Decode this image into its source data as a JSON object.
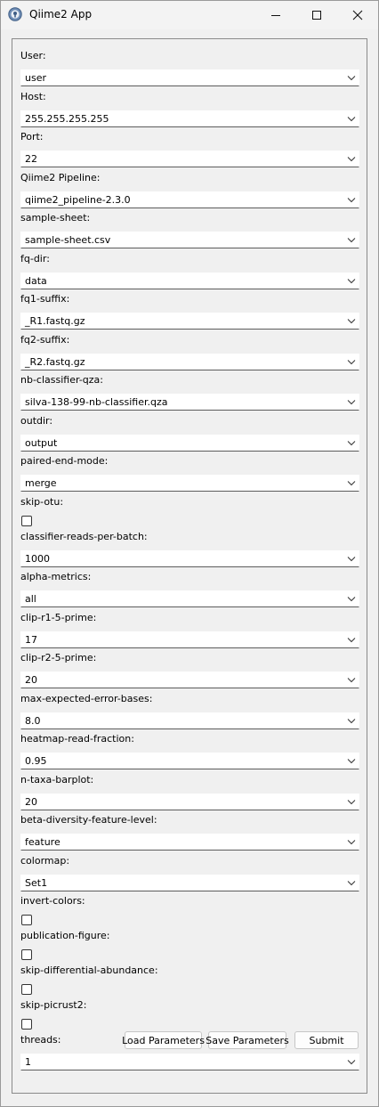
{
  "window": {
    "title": "Qiime2 App",
    "icon": "app-logo-icon",
    "controls": [
      "minimize-icon",
      "maximize-icon",
      "close-icon"
    ]
  },
  "fields": [
    {
      "label": "User:",
      "type": "combo",
      "value": "user"
    },
    {
      "label": "Host:",
      "type": "combo",
      "value": "255.255.255.255"
    },
    {
      "label": "Port:",
      "type": "combo",
      "value": "22"
    },
    {
      "label": "Qiime2 Pipeline:",
      "type": "combo",
      "value": "qiime2_pipeline-2.3.0"
    },
    {
      "label": "sample-sheet:",
      "type": "combo",
      "value": "sample-sheet.csv"
    },
    {
      "label": "fq-dir:",
      "type": "combo",
      "value": "data"
    },
    {
      "label": "fq1-suffix:",
      "type": "combo",
      "value": "_R1.fastq.gz"
    },
    {
      "label": "fq2-suffix:",
      "type": "combo",
      "value": "_R2.fastq.gz"
    },
    {
      "label": "nb-classifier-qza:",
      "type": "combo",
      "value": "silva-138-99-nb-classifier.qza"
    },
    {
      "label": "outdir:",
      "type": "combo",
      "value": "output"
    },
    {
      "label": "paired-end-mode:",
      "type": "combo",
      "value": "merge"
    },
    {
      "label": "skip-otu:",
      "type": "checkbox",
      "checked": false
    },
    {
      "label": "classifier-reads-per-batch:",
      "type": "combo",
      "value": "1000"
    },
    {
      "label": "alpha-metrics:",
      "type": "combo",
      "value": "all"
    },
    {
      "label": "clip-r1-5-prime:",
      "type": "combo",
      "value": "17"
    },
    {
      "label": "clip-r2-5-prime:",
      "type": "combo",
      "value": "20"
    },
    {
      "label": "max-expected-error-bases:",
      "type": "combo",
      "value": "8.0"
    },
    {
      "label": "heatmap-read-fraction:",
      "type": "combo",
      "value": "0.95"
    },
    {
      "label": "n-taxa-barplot:",
      "type": "combo",
      "value": "20"
    },
    {
      "label": "beta-diversity-feature-level:",
      "type": "combo",
      "value": "feature"
    },
    {
      "label": "colormap:",
      "type": "combo",
      "value": "Set1"
    },
    {
      "label": "invert-colors:",
      "type": "checkbox",
      "checked": false
    },
    {
      "label": "publication-figure:",
      "type": "checkbox",
      "checked": false
    },
    {
      "label": "skip-differential-abundance:",
      "type": "checkbox",
      "checked": false
    },
    {
      "label": "skip-picrust2:",
      "type": "checkbox",
      "checked": false
    },
    {
      "label": "threads:",
      "type": "combo",
      "value": "1"
    }
  ],
  "buttons": {
    "load": "Load Parameters",
    "save": "Save Parameters",
    "submit": "Submit"
  }
}
